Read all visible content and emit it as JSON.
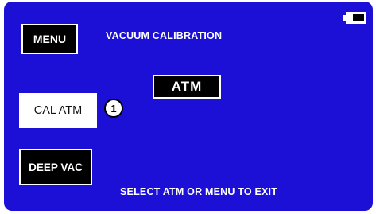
{
  "header": {
    "menu_label": "MENU",
    "title": "VACUUM CALIBRATION"
  },
  "status": {
    "battery_level": 0.65
  },
  "main": {
    "atm_label": "ATM",
    "cal_atm_label": "CAL ATM",
    "callout_number": "1",
    "deep_vac_label": "DEEP VAC"
  },
  "footer": {
    "instruction": "SELECT ATM OR MENU TO EXIT"
  },
  "colors": {
    "screen_background": "#1c0fd6",
    "button_dark": "#000000",
    "button_light": "#ffffff",
    "text": "#ffffff"
  }
}
